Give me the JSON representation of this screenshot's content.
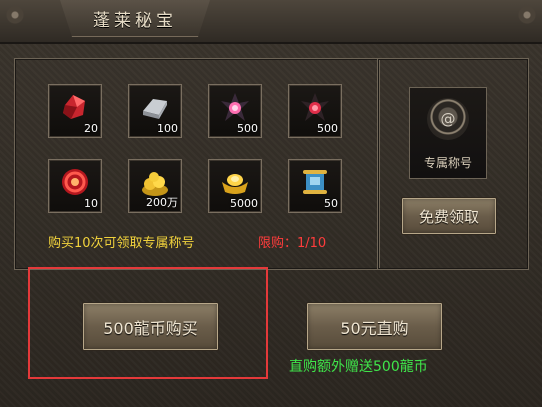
{
  "title": "蓬莱秘宝",
  "items": [
    {
      "icon": "red-gem-icon",
      "qty": "20"
    },
    {
      "icon": "silver-bar-icon",
      "qty": "100"
    },
    {
      "icon": "dark-pink-crystal-icon",
      "qty": "500"
    },
    {
      "icon": "dark-red-crystal-icon",
      "qty": "500"
    },
    {
      "icon": "red-swirl-orb-icon",
      "qty": "10"
    },
    {
      "icon": "gold-coins-pile-icon",
      "qty": "200万"
    },
    {
      "icon": "gold-ingot-icon",
      "qty": "5000"
    },
    {
      "icon": "scroll-icon",
      "qty": "50"
    }
  ],
  "hint_text": "购买10次可领取专属称号",
  "limit_text": "限购：1/10",
  "exclusive": {
    "icon": "title-badge-icon",
    "label": "专属称号"
  },
  "free_claim_label": "免费领取",
  "buy_label": "500龍币购买",
  "direct_label": "50元直购",
  "bonus_text": "直购额外赠送500龍币",
  "colors": {
    "hint": "#f1d23c",
    "limit": "#ff3c3c",
    "bonus": "#3fe54a",
    "highlight": "#e4393a"
  }
}
